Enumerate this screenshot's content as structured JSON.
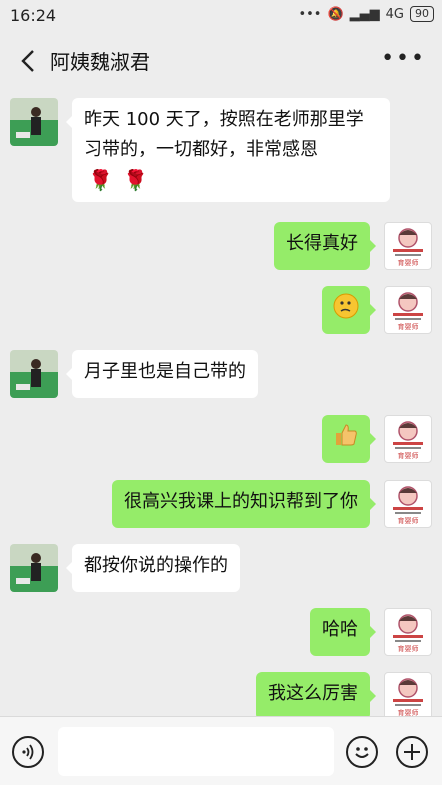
{
  "status": {
    "time": "16:24",
    "network": "4G",
    "battery": "90"
  },
  "header": {
    "title": "阿姨魏淑君"
  },
  "messages": [
    {
      "side": "left",
      "text": "昨天 100 天了，按照在老师那里学习带的，一切都好，非常感恩"
    },
    {
      "side": "right",
      "text": "长得真好"
    },
    {
      "side": "right",
      "emoji": "thinking-face"
    },
    {
      "side": "left",
      "text": "月子里也是自己带的"
    },
    {
      "side": "right",
      "emoji": "thumbs-up"
    },
    {
      "side": "right",
      "text": "很高兴我课上的知识帮到了你"
    },
    {
      "side": "left",
      "text": "都按你说的操作的"
    },
    {
      "side": "right",
      "text": "哈哈"
    },
    {
      "side": "right",
      "text": "我这么厉害"
    }
  ],
  "avatar_right_caption": "育婴师"
}
